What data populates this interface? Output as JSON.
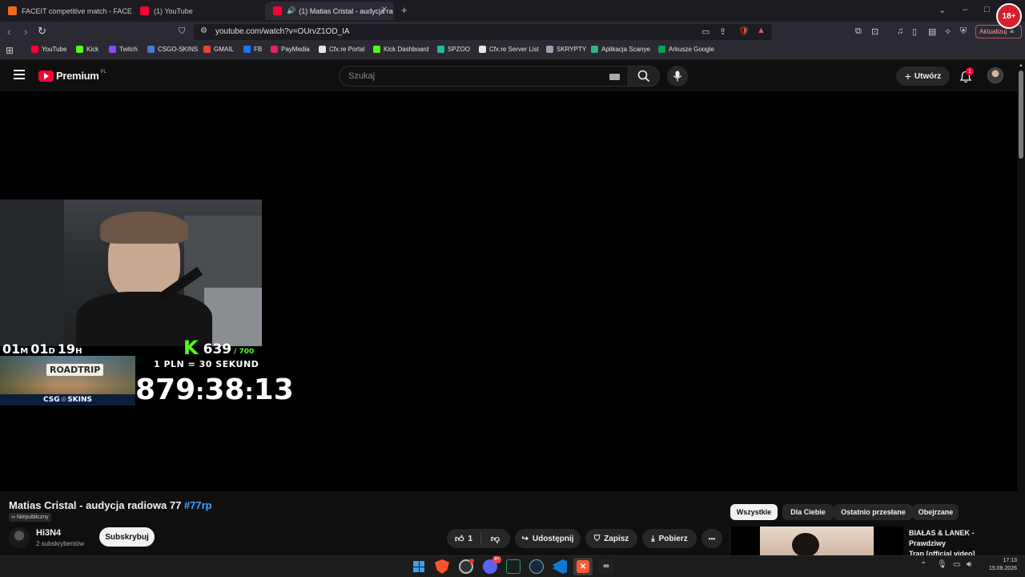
{
  "browser": {
    "tabs": [
      {
        "title": "FACEIT competitive match - FACEIT.c",
        "color": "#f26b1d"
      },
      {
        "title": "(1) YouTube",
        "color": "#ff0033"
      },
      {
        "title": "(1) Matias Cristal - audycja ra",
        "color": "#ff0033",
        "active": true
      }
    ],
    "new_tab": "+",
    "url": "youtube.com/watch?v=OUrvZ1OD_IA",
    "update_button": "Aktualizuj",
    "profile_badge": "18+",
    "bookmarks": [
      {
        "label": "YouTube",
        "color": "#ff0033"
      },
      {
        "label": "Kick",
        "color": "#53fc18"
      },
      {
        "label": "Twitch",
        "color": "#9146ff"
      },
      {
        "label": "CSGO-SKINS",
        "color": "#4a7bd0"
      },
      {
        "label": "GMAIL",
        "color": "#ea4335"
      },
      {
        "label": "FB",
        "color": "#1877f2"
      },
      {
        "label": "PayMedia",
        "color": "#e0245e"
      },
      {
        "label": "Cfx.re Portal",
        "color": "#e6e6e6"
      },
      {
        "label": "Kick Dashboard",
        "color": "#53fc18"
      },
      {
        "label": "SPZOO",
        "color": "#2bb5a0"
      },
      {
        "label": "Cfx.re Server List",
        "color": "#e6e6e6"
      },
      {
        "label": "SKRYPTY",
        "color": "#9aa0a6"
      },
      {
        "label": "Aplikacja Scanye",
        "color": "#36b37e"
      },
      {
        "label": "Arkusze Google",
        "color": "#0f9d58"
      }
    ]
  },
  "youtube": {
    "logo_text": "Premium",
    "logo_region": "PL",
    "search_placeholder": "Szukaj",
    "create_label": "Utwórz",
    "notification_count": "1",
    "accent": "#ff0033"
  },
  "overlay": {
    "countdown_parts": [
      "01",
      "M",
      "01",
      "D",
      "19",
      "H"
    ],
    "kick_current": "639",
    "kick_goal": "/ 700",
    "rate": "1 PLN = 30 SEKUND",
    "timer": [
      "879",
      ":",
      "38",
      ":",
      "13"
    ],
    "promo_title": "ROADTRIP",
    "promo_brand_left": "CSG",
    "promo_brand_right": "SKINS"
  },
  "video": {
    "title": "Matias Cristal - audycja radiowa 77",
    "hashtag": "#77rp",
    "visibility": "Niepubliczny",
    "channel_name": "Hi3N4",
    "subscribers": "2 subskrybentów",
    "subscribe_label": "Subskrybuj",
    "like_count": "1",
    "share_label": "Udostępnij",
    "save_label": "Zapisz",
    "download_label": "Pobierz",
    "more_label": "•••"
  },
  "recommendations": {
    "chips": [
      "Wszystkie",
      "Dla Ciebie",
      "Ostatnio przesłane",
      "Obejrzane"
    ],
    "first_title_line1": "BIAŁAS & LANEK - Prawdziwy",
    "first_title_line2": "Trap [official video]"
  },
  "taskbar": {
    "time": "17:13",
    "date": "15.08.2026",
    "discord_badge": "9+"
  }
}
